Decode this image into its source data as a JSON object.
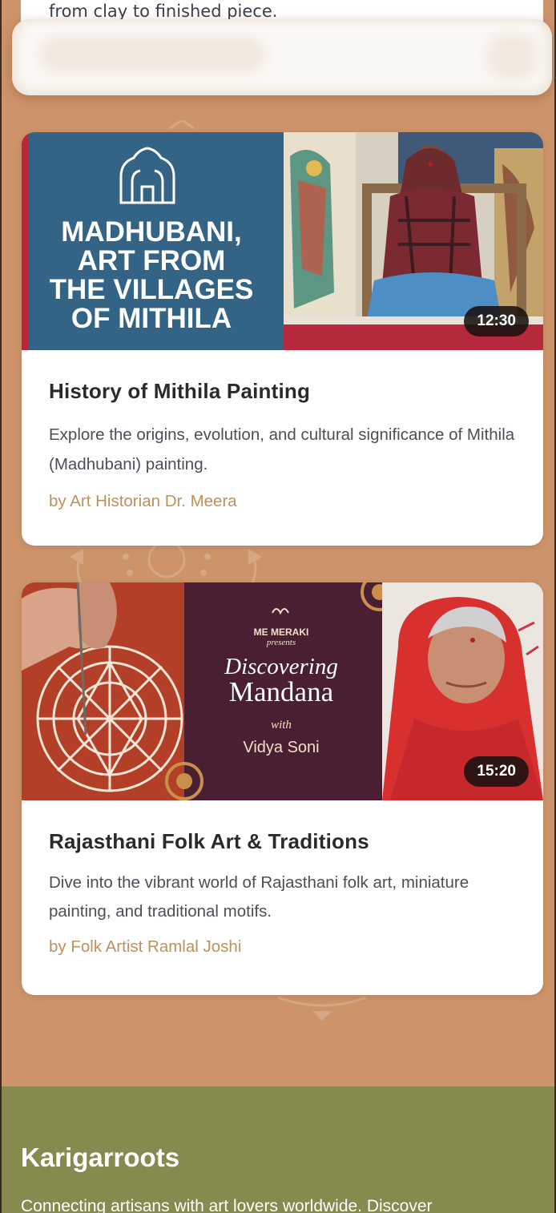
{
  "previous_card": {
    "description_tail": "from clay to finished piece."
  },
  "videos": [
    {
      "title": "History of Mithila Painting",
      "description": "Explore the origins, evolution, and cultural significance of Mithila (Madhubani) painting.",
      "author": "by Art Historian Dr. Meera",
      "duration": "12:30",
      "thumbnail_text": [
        "MADHUBANI,",
        "ART FROM",
        "THE VILLAGES",
        "OF MITHILA"
      ]
    },
    {
      "title": "Rajasthani Folk Art & Traditions",
      "description": "Dive into the vibrant world of Rajasthani folk art, miniature painting, and traditional motifs.",
      "author": "by Folk Artist Ramlal Joshi",
      "duration": "15:20",
      "thumbnail_text": {
        "brand": "ME MERAKI",
        "presents": "presents",
        "line1": "Discovering",
        "line2": "Mandana",
        "with": "with",
        "host": "Vidya Soni"
      }
    }
  ],
  "footer": {
    "brand": "Karigarroots",
    "tagline": "Connecting artisans with art lovers worldwide. Discover"
  },
  "colors": {
    "page_background": "#cd946b",
    "footer_background": "#868a4f",
    "author_accent": "#c0905c",
    "madhubani_blue": "#336385"
  }
}
